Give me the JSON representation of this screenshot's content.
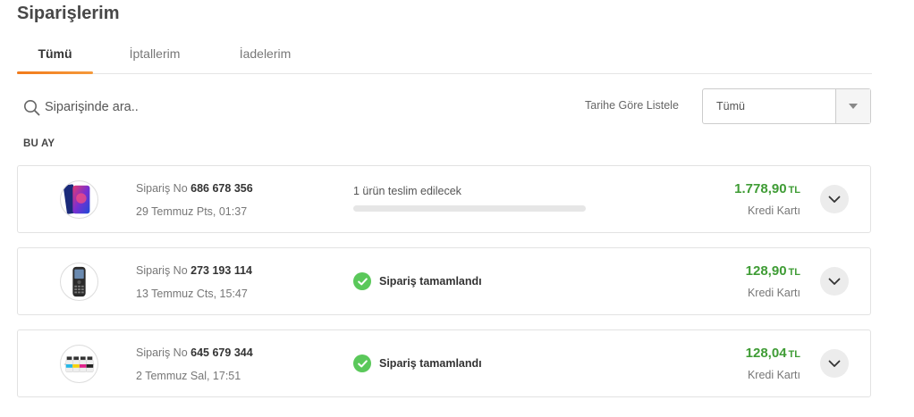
{
  "page": {
    "title": "Siparişlerim"
  },
  "tabs": [
    {
      "label": "Tümü",
      "active": true
    },
    {
      "label": "İptallerim",
      "active": false
    },
    {
      "label": "İadelerim",
      "active": false
    }
  ],
  "search": {
    "placeholder": "Siparişinde ara.."
  },
  "filter": {
    "label": "Tarihe Göre Listele",
    "selected": "Tümü"
  },
  "section": {
    "title": "BU AY"
  },
  "colors": {
    "accent": "#f27a1a",
    "price": "#3f9c35",
    "success": "#5ac85a"
  },
  "orders": [
    {
      "no_label": "Sipariş No",
      "no": "686 678 356",
      "date": "29 Temmuz Pts, 01:37",
      "status": "1 ürün teslim edilecek",
      "progress": 0,
      "price": "1.778,90",
      "currency": "TL",
      "payment": "Kredi Kartı",
      "thumb_icon": "smartphone-icon"
    },
    {
      "no_label": "Sipariş No",
      "no": "273 193 114",
      "date": "13 Temmuz Cts, 15:47",
      "status": "Sipariş tamamlandı",
      "price": "128,90",
      "currency": "TL",
      "payment": "Kredi Kartı",
      "thumb_icon": "feature-phone-icon"
    },
    {
      "no_label": "Sipariş No",
      "no": "645 679 344",
      "date": "2 Temmuz Sal, 17:51",
      "status": "Sipariş tamamlandı",
      "price": "128,04",
      "currency": "TL",
      "payment": "Kredi Kartı",
      "thumb_icon": "ink-bottles-icon"
    }
  ]
}
